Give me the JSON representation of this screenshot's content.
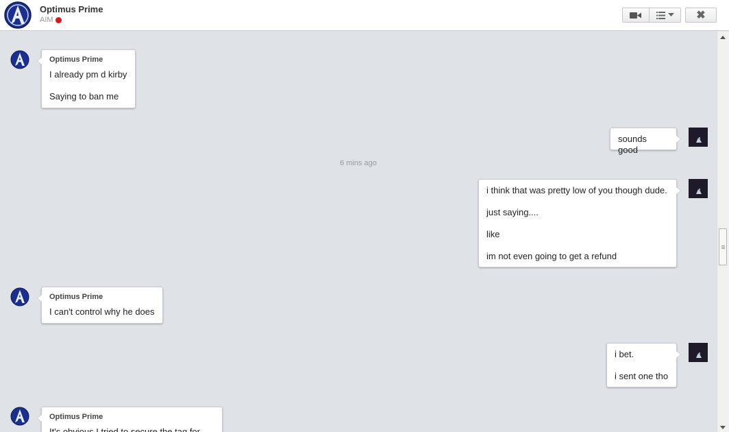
{
  "header": {
    "contact_name": "Optimus Prime",
    "service": "AIM",
    "status_color": "#d7191c"
  },
  "toolbar": {
    "video_icon": "video-camera-icon",
    "menu_icon": "list-menu-icon",
    "close_glyph": "✖"
  },
  "messages": {
    "m1": {
      "sender": "Optimus Prime",
      "lines": [
        "I already pm d kirby",
        "Saying to ban me"
      ]
    },
    "m2": {
      "lines": [
        "sounds good"
      ]
    },
    "timestamp": "6 mins ago",
    "m3": {
      "lines": [
        "i think that was pretty low of you though dude.",
        "just saying....",
        "like",
        "im not even going to get a refund"
      ]
    },
    "m4": {
      "sender": "Optimus Prime",
      "lines": [
        "I can't control why he does"
      ]
    },
    "m5": {
      "lines": [
        "i bet.",
        "i sent one tho"
      ]
    },
    "m6": {
      "sender": "Optimus Prime",
      "lines": [
        "It's obvious I tried to secure the tag for me"
      ]
    }
  },
  "colors": {
    "chat_background": "#dfe3e7",
    "bubble_background": "#ffffff"
  }
}
